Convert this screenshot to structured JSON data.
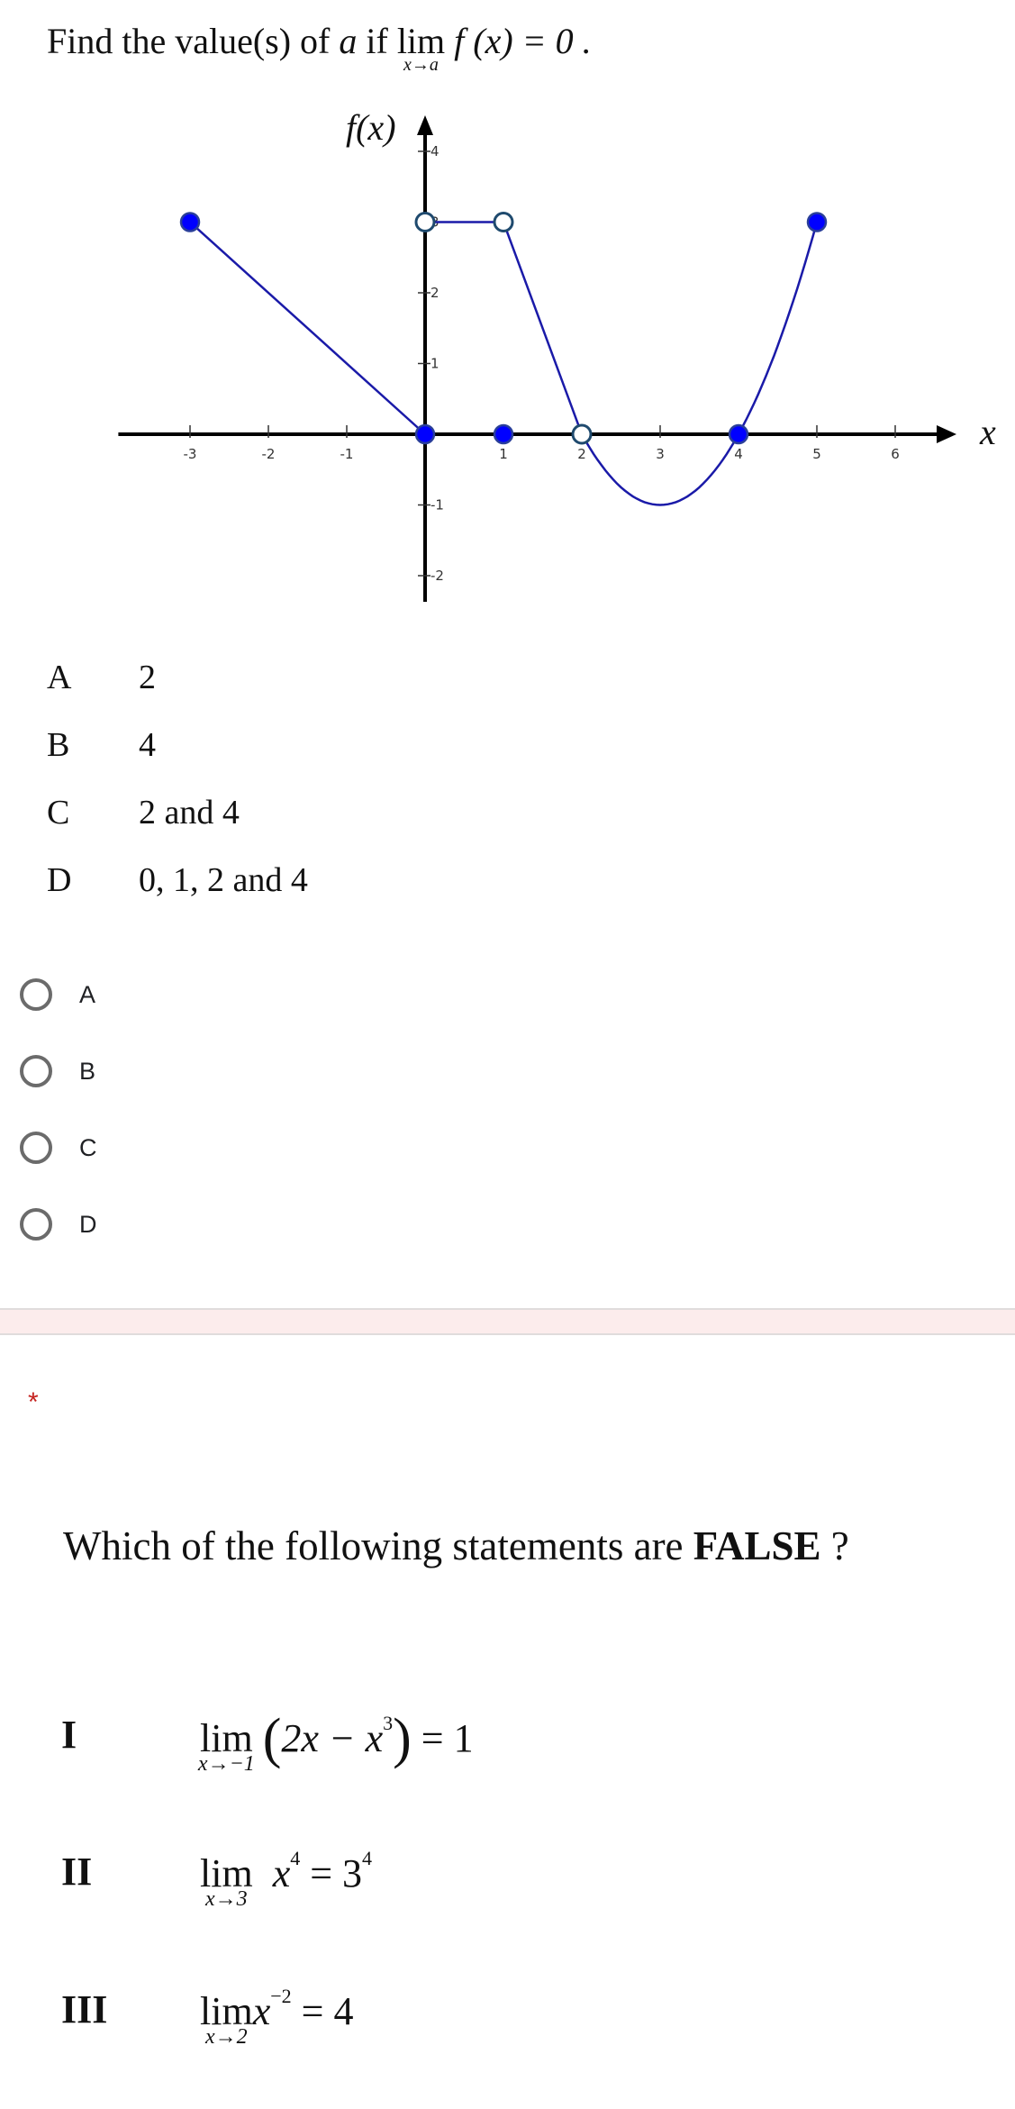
{
  "question1": {
    "prompt_prefix": "Find the value(s) of ",
    "prompt_var": "a",
    "prompt_mid": " if ",
    "lim_word": "lim",
    "lim_sub": "x→a",
    "prompt_expr": "f (x) = 0 .",
    "choices": [
      {
        "letter": "A",
        "text": "2"
      },
      {
        "letter": "B",
        "text": "4"
      },
      {
        "letter": "C",
        "text": "2 and 4"
      },
      {
        "letter": "D",
        "text": "0, 1, 2 and 4"
      }
    ],
    "radio_options": [
      {
        "label": "A",
        "selected": false
      },
      {
        "label": "B",
        "selected": false
      },
      {
        "label": "C",
        "selected": false
      },
      {
        "label": "D",
        "selected": false
      }
    ]
  },
  "chart_data": {
    "type": "line",
    "title": "",
    "xlabel": "x",
    "ylabel": "f(x)",
    "xlim": [
      -3.8,
      6.7
    ],
    "ylim": [
      -2.5,
      4.3
    ],
    "x_ticks": [
      -3,
      -2,
      -1,
      1,
      2,
      3,
      4,
      5,
      6
    ],
    "y_ticks": [
      -2,
      -1,
      1,
      2,
      3,
      4
    ],
    "grid": false,
    "line_color": "#1a1aa8",
    "segments": [
      {
        "kind": "linear",
        "points": [
          [
            -3,
            3
          ],
          [
            0,
            0
          ]
        ]
      },
      {
        "kind": "linear",
        "points": [
          [
            0,
            3
          ],
          [
            1,
            3
          ]
        ]
      },
      {
        "kind": "linear",
        "points": [
          [
            1,
            3
          ],
          [
            2,
            0
          ]
        ]
      },
      {
        "kind": "parabola",
        "vertex": [
          3,
          -1
        ],
        "from": 2,
        "to": 5,
        "formula": "(x-3)^2 - 1"
      }
    ],
    "filled_points": [
      [
        -3,
        3
      ],
      [
        0,
        0
      ],
      [
        1,
        0
      ],
      [
        4,
        0
      ],
      [
        5,
        3
      ]
    ],
    "open_points": [
      [
        0,
        3
      ],
      [
        1,
        3
      ],
      [
        2,
        0
      ]
    ]
  },
  "question2": {
    "required_marker": "*",
    "prompt_prefix": "Which of the following statements are ",
    "prompt_bold": "FALSE",
    "prompt_suffix": " ?",
    "statements": [
      {
        "numeral": "I",
        "lim_sub": "x→−1",
        "expr_open": "(",
        "expr_body": "2x − x",
        "exp": "3",
        "expr_close": ")",
        "rhs": " = 1"
      },
      {
        "numeral": "II",
        "lim_sub": "x→3",
        "base": "x",
        "exp": "4",
        "rhs_base": " = 3",
        "rhs_exp": "4"
      },
      {
        "numeral": "III",
        "lim_sub": "x→2",
        "base": "x",
        "exp": "−2",
        "rhs": " = 4"
      }
    ]
  }
}
